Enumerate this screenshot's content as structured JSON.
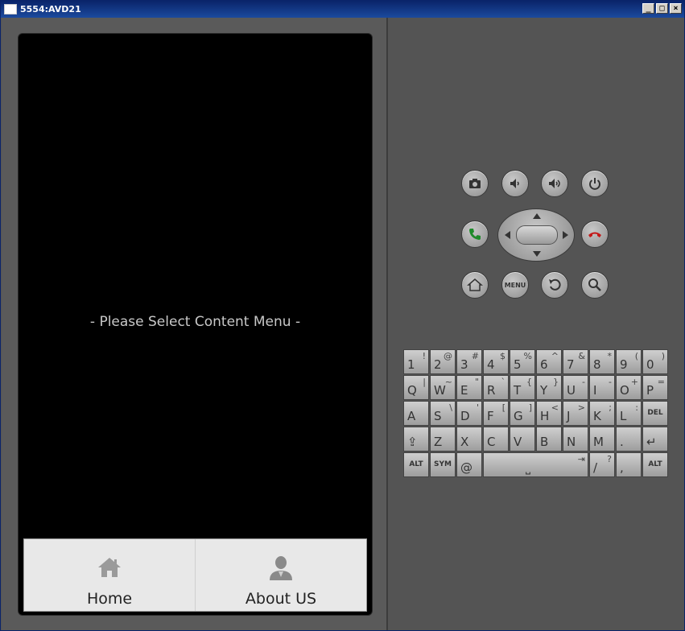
{
  "window": {
    "title": "5554:AVD21",
    "controls": [
      "_",
      "□",
      "×"
    ]
  },
  "screen": {
    "message": "- Please Select Content Menu -",
    "tabs": [
      {
        "label": "Home",
        "icon": "home-icon"
      },
      {
        "label": "About US",
        "icon": "person-icon"
      }
    ]
  },
  "hardware": {
    "menu_label": "MENU",
    "buttons": [
      "camera-icon",
      "volume-down-icon",
      "volume-up-icon",
      "power-icon",
      "call-icon",
      "end-call-icon",
      "home-icon",
      "menu-button",
      "back-icon",
      "search-icon"
    ]
  },
  "keyboard": {
    "rows": [
      [
        {
          "m": "1",
          "a": "!"
        },
        {
          "m": "2",
          "a": "@"
        },
        {
          "m": "3",
          "a": "#"
        },
        {
          "m": "4",
          "a": "$"
        },
        {
          "m": "5",
          "a": "%"
        },
        {
          "m": "6",
          "a": "^"
        },
        {
          "m": "7",
          "a": "&"
        },
        {
          "m": "8",
          "a": "*"
        },
        {
          "m": "9",
          "a": "("
        },
        {
          "m": "0",
          "a": ")"
        }
      ],
      [
        {
          "m": "Q",
          "a": "|"
        },
        {
          "m": "W",
          "a": "~"
        },
        {
          "m": "E",
          "a": "\""
        },
        {
          "m": "R",
          "a": "`"
        },
        {
          "m": "T",
          "a": "{"
        },
        {
          "m": "Y",
          "a": "}"
        },
        {
          "m": "U",
          "a": "-"
        },
        {
          "m": "I",
          "a": "-"
        },
        {
          "m": "O",
          "a": "+"
        },
        {
          "m": "P",
          "a": "="
        }
      ],
      [
        {
          "m": "A",
          "a": ""
        },
        {
          "m": "S",
          "a": "\\"
        },
        {
          "m": "D",
          "a": "'"
        },
        {
          "m": "F",
          "a": "["
        },
        {
          "m": "G",
          "a": "]"
        },
        {
          "m": "H",
          "a": "<"
        },
        {
          "m": "J",
          "a": ">"
        },
        {
          "m": "K",
          "a": ";"
        },
        {
          "m": "L",
          "a": ":"
        },
        {
          "m": "",
          "a": "",
          "s": "DEL"
        }
      ],
      [
        {
          "m": "⇪",
          "a": ""
        },
        {
          "m": "Z",
          "a": ""
        },
        {
          "m": "X",
          "a": ""
        },
        {
          "m": "C",
          "a": ""
        },
        {
          "m": "V",
          "a": ""
        },
        {
          "m": "B",
          "a": ""
        },
        {
          "m": "N",
          "a": ""
        },
        {
          "m": "M",
          "a": ""
        },
        {
          "m": ".",
          "a": ""
        },
        {
          "m": "↵",
          "a": ""
        }
      ],
      [
        {
          "m": "",
          "a": "",
          "s": "ALT"
        },
        {
          "m": "",
          "a": "",
          "s": "SYM"
        },
        {
          "m": "@",
          "a": ""
        },
        {
          "m": "⎵",
          "a": "⇥",
          "wide": true
        },
        {
          "m": "/",
          "a": "?"
        },
        {
          "m": ",",
          "a": ""
        },
        {
          "m": "",
          "a": "",
          "s": "ALT"
        }
      ]
    ]
  }
}
